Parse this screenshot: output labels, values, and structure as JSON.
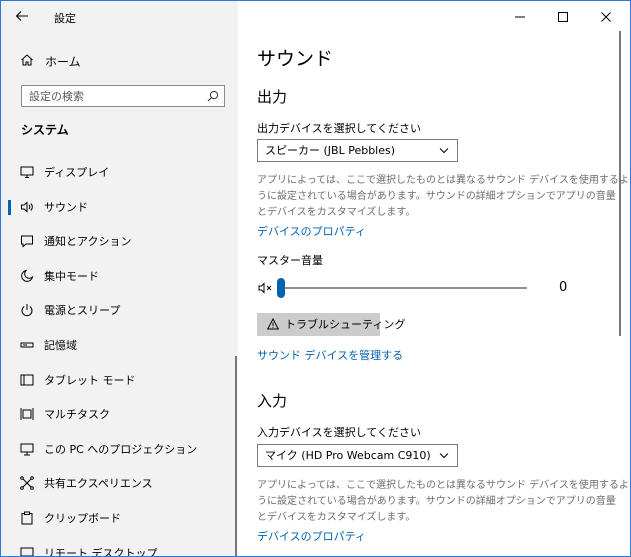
{
  "window": {
    "app_title": "設定"
  },
  "sidebar": {
    "home_label": "ホーム",
    "search_placeholder": "設定の検索",
    "section_title": "システム",
    "items": [
      {
        "label": "ディスプレイ",
        "icon": "monitor-icon"
      },
      {
        "label": "サウンド",
        "icon": "speaker-icon",
        "active": true
      },
      {
        "label": "通知とアクション",
        "icon": "notification-icon"
      },
      {
        "label": "集中モード",
        "icon": "moon-icon"
      },
      {
        "label": "電源とスリープ",
        "icon": "power-icon"
      },
      {
        "label": "記憶域",
        "icon": "storage-icon"
      },
      {
        "label": "タブレット モード",
        "icon": "tablet-icon"
      },
      {
        "label": "マルチタスク",
        "icon": "multitask-icon"
      },
      {
        "label": "この PC へのプロジェクション",
        "icon": "projection-icon"
      },
      {
        "label": "共有エクスペリエンス",
        "icon": "share-icon"
      },
      {
        "label": "クリップボード",
        "icon": "clipboard-icon"
      },
      {
        "label": "リモート デスクトップ",
        "icon": "remote-icon"
      }
    ]
  },
  "main": {
    "page_title": "サウンド",
    "output": {
      "heading": "出力",
      "select_label": "出力デバイスを選択してください",
      "selected_device": "スピーカー (JBL Pebbles)",
      "description_lines": [
        "アプリによっては、ここで選択したものとは異なるサウンド デバイスを使用するよ",
        "うに設定されている場合があります。サウンドの詳細オプションでアプリの音量",
        "とデバイスをカスタマイズします。"
      ],
      "properties_link": "デバイスのプロパティ",
      "master_volume_label": "マスター音量",
      "volume_value": "0",
      "volume_fraction": 0,
      "troubleshoot_label": "トラブルシューティング",
      "manage_link": "サウンド デバイスを管理する"
    },
    "input": {
      "heading": "入力",
      "select_label": "入力デバイスを選択してください",
      "selected_device": "マイク (HD Pro Webcam C910)",
      "description_lines": [
        "アプリによっては、ここで選択したものとは異なるサウンド デバイスを使用するよ",
        "うに設定されている場合があります。サウンドの詳細オプションでアプリの音量",
        "とデバイスをカスタマイズします。"
      ],
      "properties_link": "デバイスのプロパティ"
    }
  },
  "colors": {
    "accent": "#0063b1",
    "sidebar_bg": "#f2f2f2",
    "button_bg": "#cccccc"
  }
}
